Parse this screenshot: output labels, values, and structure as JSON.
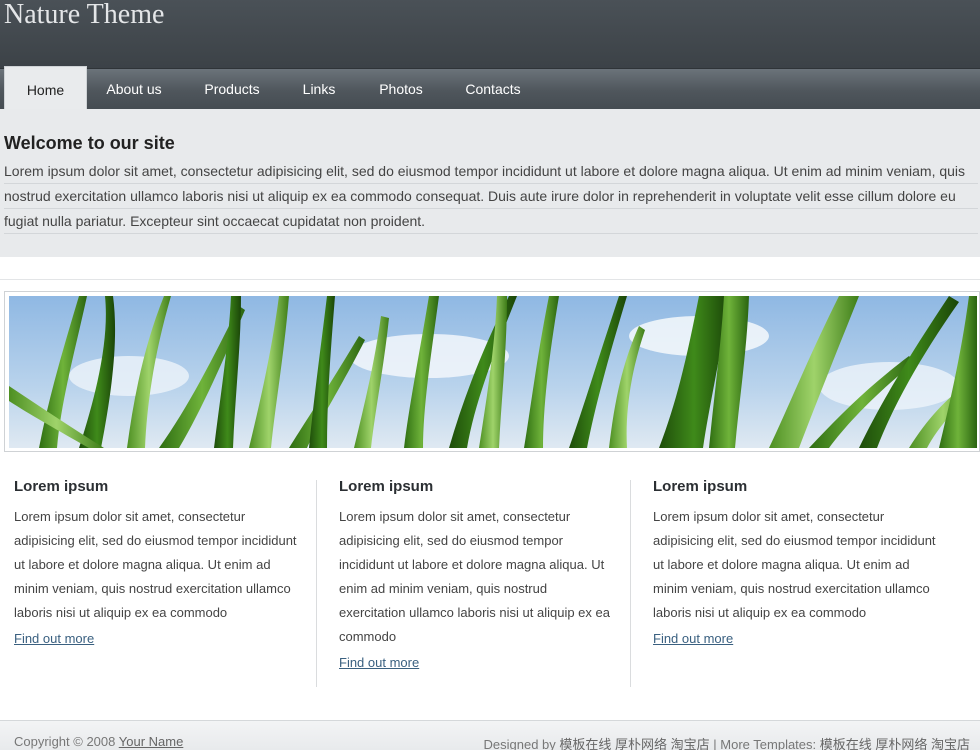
{
  "header": {
    "site_title": "Nature Theme"
  },
  "nav": {
    "items": [
      {
        "label": "Home",
        "active": true
      },
      {
        "label": "About us"
      },
      {
        "label": "Products"
      },
      {
        "label": "Links"
      },
      {
        "label": "Photos"
      },
      {
        "label": "Contacts"
      }
    ]
  },
  "welcome": {
    "title": "Welcome to our site",
    "text": "Lorem ipsum dolor sit amet, consectetur adipisicing elit, sed do eiusmod tempor incididunt ut labore et dolore magna aliqua. Ut enim ad minim veniam, quis nostrud exercitation ullamco laboris nisi ut aliquip ex ea commodo consequat. Duis aute irure dolor in reprehenderit in voluptate velit esse cillum dolore eu fugiat nulla pariatur. Excepteur sint occaecat cupidatat non proident."
  },
  "columns": [
    {
      "title": "Lorem ipsum",
      "text": "Lorem ipsum dolor sit amet, consectetur adipisicing elit, sed do eiusmod tempor incididunt ut labore et dolore magna aliqua. Ut enim ad minim veniam, quis nostrud exercitation ullamco laboris nisi ut aliquip ex ea commodo",
      "link": "Find out more"
    },
    {
      "title": "Lorem ipsum",
      "text": "Lorem ipsum dolor sit amet, consectetur adipisicing elit, sed do eiusmod tempor incididunt ut labore et dolore magna aliqua. Ut enim ad minim veniam, quis nostrud exercitation ullamco laboris nisi ut aliquip ex ea commodo",
      "link": "Find out more"
    },
    {
      "title": "Lorem ipsum",
      "text": "Lorem ipsum dolor sit amet, consectetur adipisicing elit, sed do eiusmod tempor incididunt ut labore et dolore magna aliqua. Ut enim ad minim veniam, quis nostrud exercitation ullamco laboris nisi ut aliquip ex ea commodo",
      "link": "Find out more"
    }
  ],
  "footer": {
    "copyright_prefix": "Copyright © 2008",
    "copyright_link": "Your Name",
    "designed_by_prefix": "Designed by",
    "designed_by_link": "模板在线 厚朴网络 淘宝店",
    "separator": "|",
    "more_templates_prefix": "More Templates:",
    "more_templates_link": "模板在线 厚朴网络 淘宝店"
  },
  "colors": {
    "header_bg": "#40474c",
    "nav_bg": "#555c62",
    "welcome_bg": "#e8eaec",
    "link": "#3a6080",
    "grass_green": "#3d8a1f",
    "sky_blue": "#a9c9e8"
  },
  "banner": {
    "icon": "grass-banner-image"
  }
}
